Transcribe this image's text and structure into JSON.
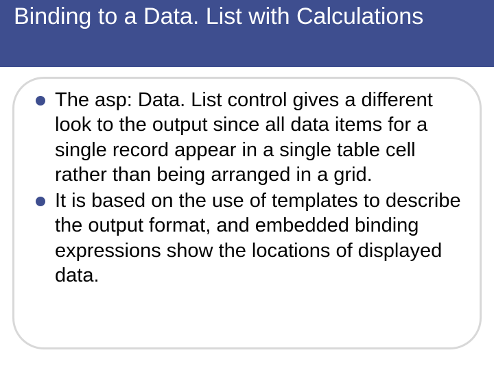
{
  "title": "Binding to a Data. List with Calculations",
  "bullets": [
    "The asp: Data. List control gives a different look to the output since all data items for a single record appear in a single table cell rather than being arranged in a grid.",
    "It is based on the use of templates to describe the output format, and embedded binding expressions show the locations of displayed data."
  ]
}
